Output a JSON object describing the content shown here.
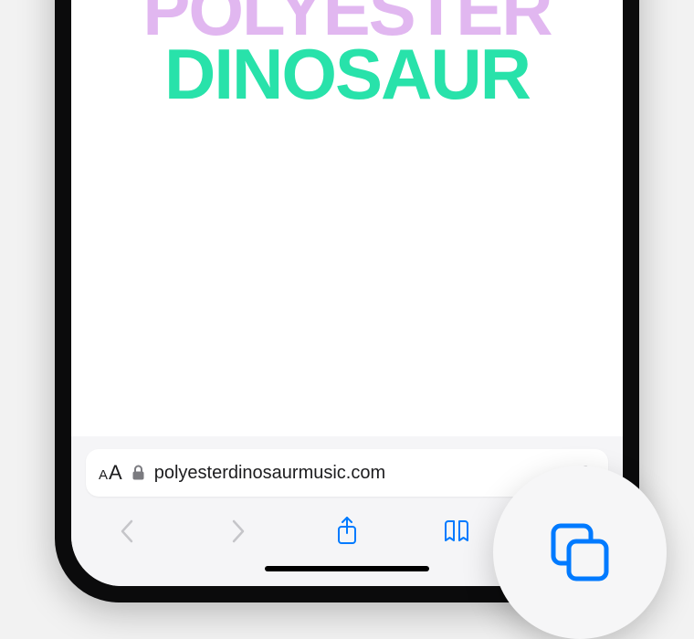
{
  "webpage": {
    "heroLine1": "POLYESTER",
    "heroLine2": "DINOSAUR"
  },
  "addressBar": {
    "textSizeSmall": "A",
    "textSizeLarge": "A",
    "url": "polyesterdinosaurmusic.com"
  },
  "colors": {
    "accentBlue": "#007aff",
    "mint": "#28e2aa",
    "lilac": "#e1b7f0"
  }
}
